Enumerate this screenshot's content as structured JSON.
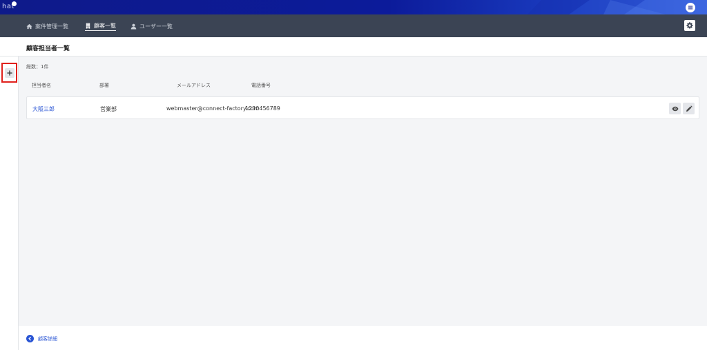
{
  "brand": {
    "logo_text": "hat"
  },
  "nav": {
    "items": [
      {
        "label": "案件管理一覧",
        "icon": "home-icon",
        "active": false
      },
      {
        "label": "顧客一覧",
        "icon": "building-icon",
        "active": true
      },
      {
        "label": "ユーザー一覧",
        "icon": "user-icon",
        "active": false
      }
    ]
  },
  "page": {
    "title": "顧客担当者一覧"
  },
  "list": {
    "count_text": "総数：1件",
    "columns": [
      "担当者名",
      "部署",
      "メールアドレス",
      "電話番号"
    ],
    "rows": [
      {
        "name": "大阪三郎",
        "department": "営業部",
        "email": "webmaster@connect-factory.com",
        "phone": "1230456789"
      }
    ]
  },
  "footer": {
    "back_label": "顧客詳細"
  },
  "colors": {
    "nav_bg": "#3b4454",
    "brand_blue": "#0e1a8a",
    "link": "#2a55d4",
    "highlight": "#e0201c"
  }
}
